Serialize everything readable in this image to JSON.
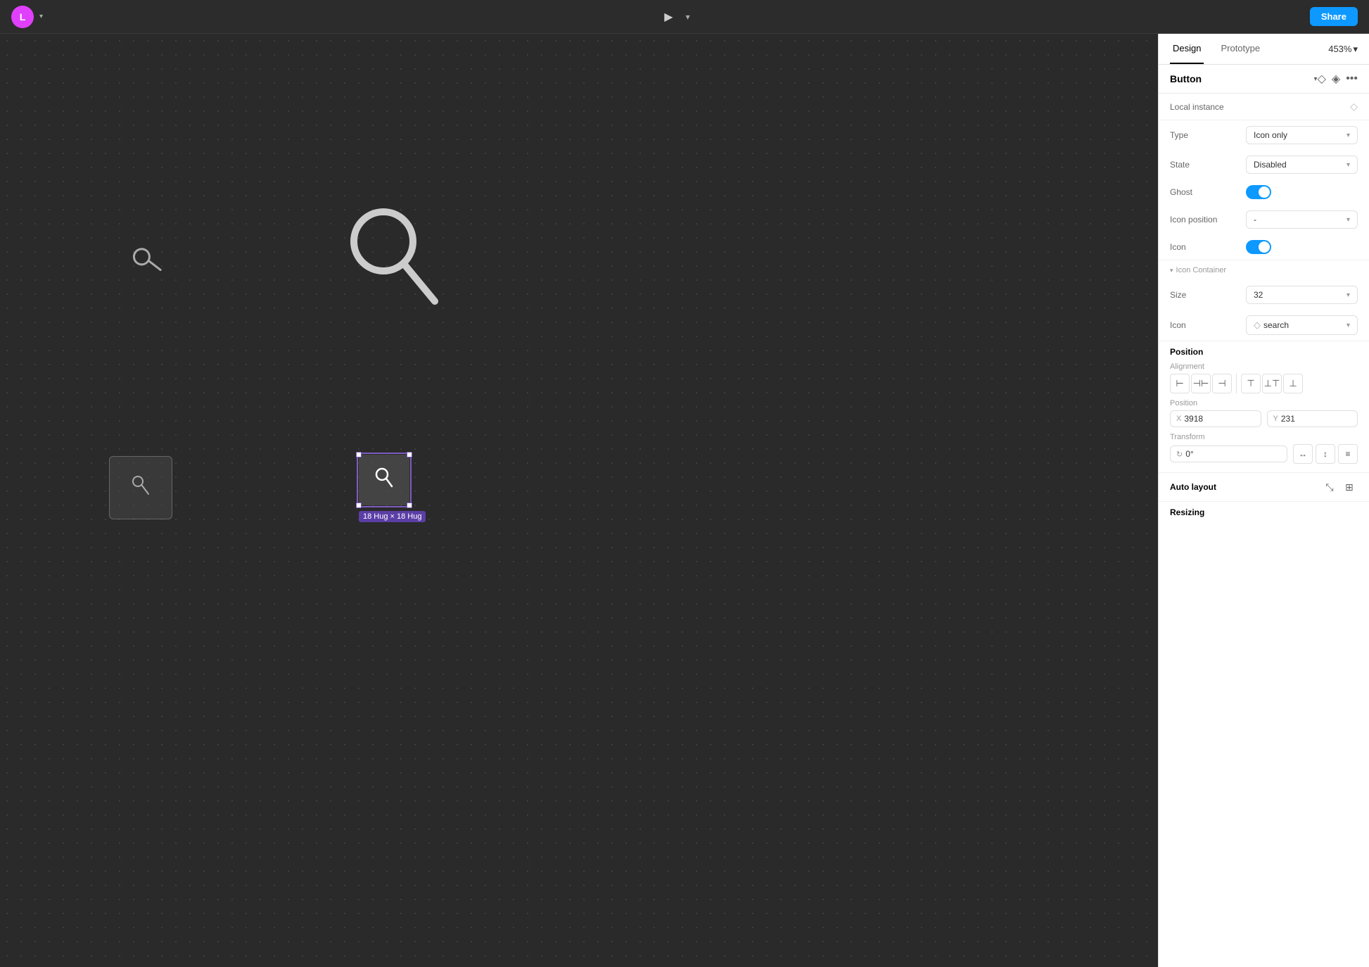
{
  "topbar": {
    "avatar_letter": "L",
    "play_icon": "▶",
    "share_label": "Share",
    "zoom_level": "453%"
  },
  "tabs": {
    "design_label": "Design",
    "prototype_label": "Prototype"
  },
  "component": {
    "name": "Button",
    "local_instance_label": "Local instance"
  },
  "properties": {
    "type_label": "Type",
    "type_value": "Icon only",
    "state_label": "State",
    "state_value": "Disabled",
    "ghost_label": "Ghost",
    "icon_position_label": "Icon position",
    "icon_position_value": "-",
    "icon_label": "Icon"
  },
  "icon_container": {
    "section_label": "Icon Container",
    "size_label": "Size",
    "size_value": "32",
    "icon_label": "Icon",
    "icon_value": "search"
  },
  "position": {
    "section_label": "Position",
    "alignment_label": "Alignment",
    "position_label": "Position",
    "x_label": "X",
    "x_value": "3918",
    "y_label": "Y",
    "y_value": "231",
    "transform_label": "Transform",
    "rotation_value": "0°"
  },
  "auto_layout": {
    "section_label": "Auto layout"
  },
  "resizing": {
    "section_label": "Resizing"
  },
  "canvas": {
    "size_label": "18 Hug × 18 Hug"
  }
}
